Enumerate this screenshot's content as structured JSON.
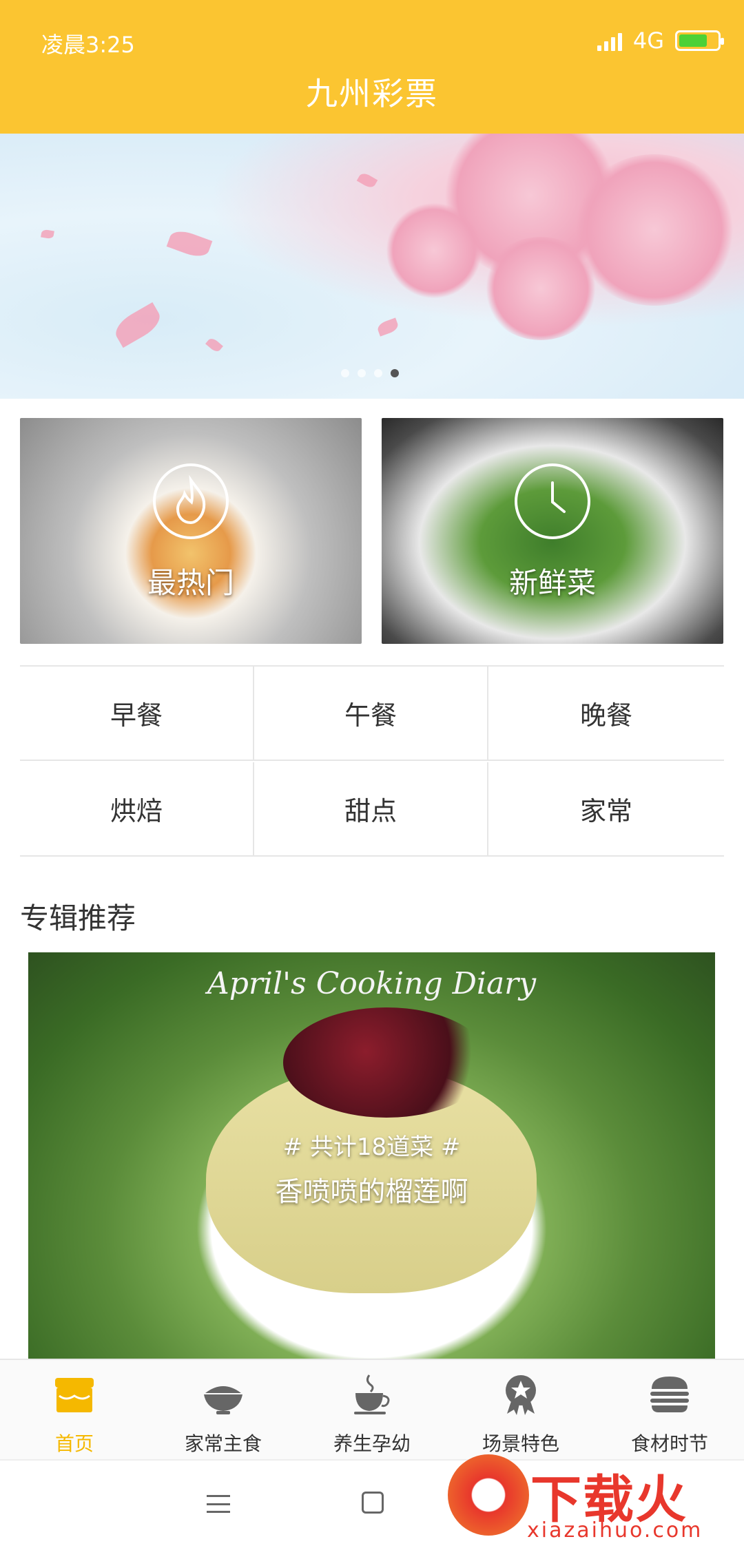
{
  "status_bar": {
    "time": "凌晨3:25",
    "network": "4G"
  },
  "header": {
    "title": "九州彩票"
  },
  "banner": {
    "slide_count": 4,
    "active_slide": 4
  },
  "features": [
    {
      "label": "最热门",
      "icon": "fire-icon"
    },
    {
      "label": "新鲜菜",
      "icon": "clock-icon"
    }
  ],
  "meals": [
    "早餐",
    "午餐",
    "晚餐",
    "烘焙",
    "甜点",
    "家常"
  ],
  "section": {
    "title": "专辑推荐"
  },
  "album": {
    "header": "April's Cooking Diary",
    "count": "# 共计18道菜 #",
    "name": "香喷喷的榴莲啊"
  },
  "tabs": [
    {
      "label": "首页",
      "icon": "shop-icon",
      "active": true
    },
    {
      "label": "家常主食",
      "icon": "rice-bowl-icon",
      "active": false
    },
    {
      "label": "养生孕幼",
      "icon": "teacup-icon",
      "active": false
    },
    {
      "label": "场景特色",
      "icon": "badge-icon",
      "active": false
    },
    {
      "label": "食材时节",
      "icon": "burger-icon",
      "active": false
    }
  ],
  "watermark": {
    "text": "下载火",
    "url": "xiazaihuo.com"
  },
  "colors": {
    "accent": "#FBC531",
    "active_tab": "#F5B800",
    "watermark": "#e8372c"
  }
}
